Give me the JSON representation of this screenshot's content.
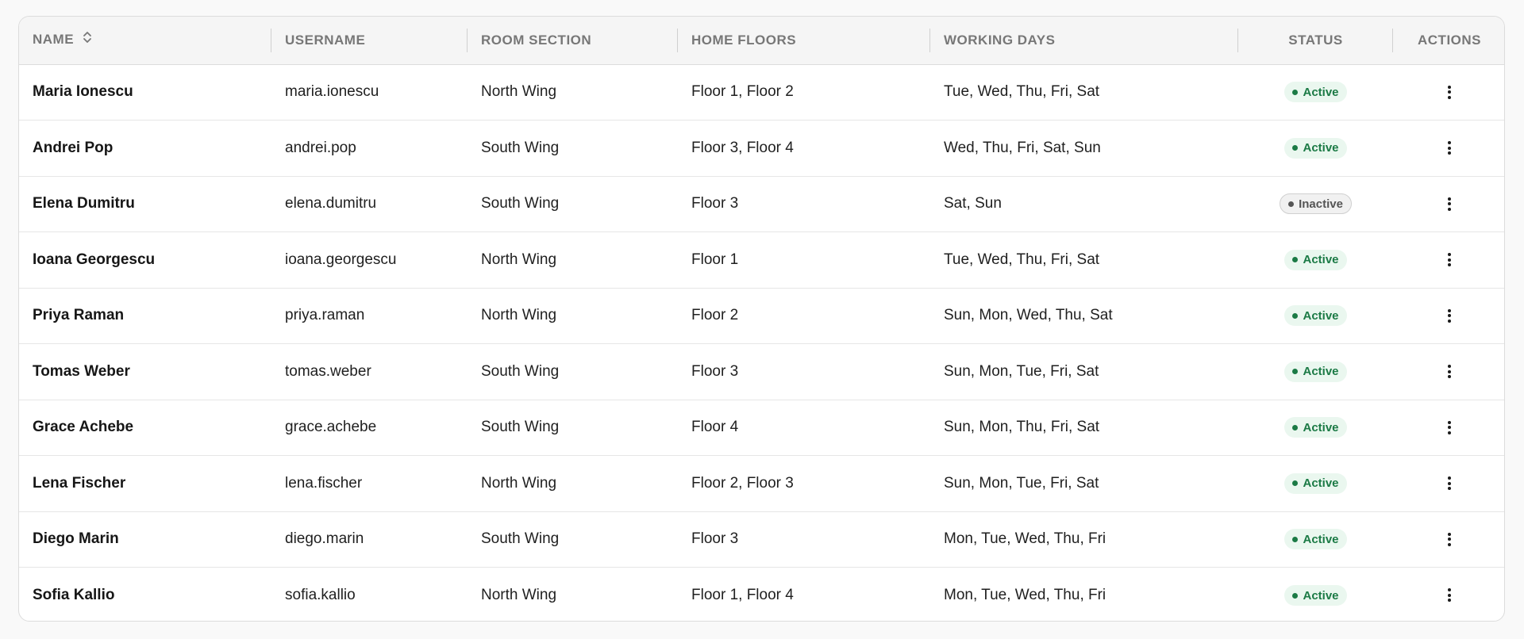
{
  "columns": {
    "name": "NAME",
    "username": "USERNAME",
    "room_section": "ROOM SECTION",
    "home_floors": "HOME FLOORS",
    "working_days": "WORKING DAYS",
    "status": "STATUS",
    "actions": "ACTIONS"
  },
  "sort_icon": "chevron-up-down-icon",
  "action_icon": "more-vertical-icon",
  "colors": {
    "active_text": "#1b7a45",
    "active_bg": "#eaf7ef",
    "inactive_text": "#555555",
    "inactive_bg": "#f1f1f1"
  },
  "rows": [
    {
      "name": "Maria Ionescu",
      "username": "maria.ionescu",
      "room_section": "North Wing",
      "home_floors": "Floor 1, Floor 2",
      "working_days": "Tue, Wed, Thu, Fri, Sat",
      "status": "Active"
    },
    {
      "name": "Andrei Pop",
      "username": "andrei.pop",
      "room_section": "South Wing",
      "home_floors": "Floor 3, Floor 4",
      "working_days": "Wed, Thu, Fri, Sat, Sun",
      "status": "Active"
    },
    {
      "name": "Elena Dumitru",
      "username": "elena.dumitru",
      "room_section": "South Wing",
      "home_floors": "Floor 3",
      "working_days": "Sat, Sun",
      "status": "Inactive"
    },
    {
      "name": "Ioana Georgescu",
      "username": "ioana.georgescu",
      "room_section": "North Wing",
      "home_floors": "Floor 1",
      "working_days": "Tue, Wed, Thu, Fri, Sat",
      "status": "Active"
    },
    {
      "name": "Priya Raman",
      "username": "priya.raman",
      "room_section": "North Wing",
      "home_floors": "Floor 2",
      "working_days": "Sun, Mon, Wed, Thu, Sat",
      "status": "Active"
    },
    {
      "name": "Tomas Weber",
      "username": "tomas.weber",
      "room_section": "South Wing",
      "home_floors": "Floor 3",
      "working_days": "Sun, Mon, Tue, Fri, Sat",
      "status": "Active"
    },
    {
      "name": "Grace Achebe",
      "username": "grace.achebe",
      "room_section": "South Wing",
      "home_floors": "Floor 4",
      "working_days": "Sun, Mon, Thu, Fri, Sat",
      "status": "Active"
    },
    {
      "name": "Lena Fischer",
      "username": "lena.fischer",
      "room_section": "North Wing",
      "home_floors": "Floor 2, Floor 3",
      "working_days": "Sun, Mon, Tue, Fri, Sat",
      "status": "Active"
    },
    {
      "name": "Diego Marin",
      "username": "diego.marin",
      "room_section": "South Wing",
      "home_floors": "Floor 3",
      "working_days": "Mon, Tue, Wed, Thu, Fri",
      "status": "Active"
    },
    {
      "name": "Sofia Kallio",
      "username": "sofia.kallio",
      "room_section": "North Wing",
      "home_floors": "Floor 1, Floor 4",
      "working_days": "Mon, Tue, Wed, Thu, Fri",
      "status": "Active"
    }
  ]
}
